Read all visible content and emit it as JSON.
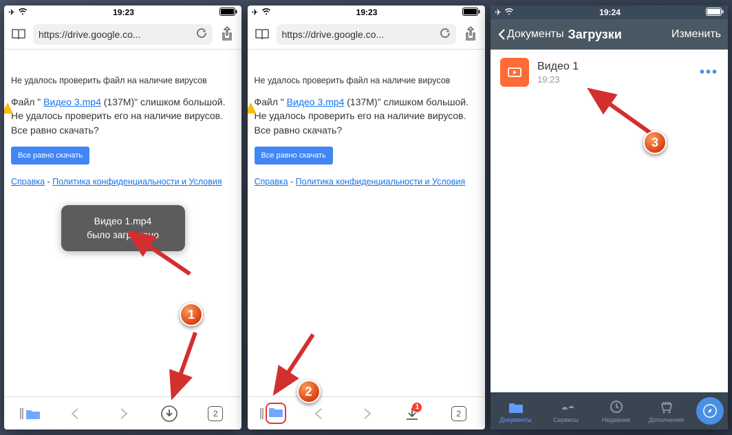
{
  "status": {
    "time1": "19:23",
    "time2": "19:23",
    "time3": "19:24"
  },
  "browser": {
    "url": "https://drive.google.co..."
  },
  "page": {
    "virus_title": "Не удалось проверить файл на наличие вирусов",
    "body_pre": "Файл \" ",
    "file_link": "Видео 3.mp4",
    "body_post": " (137M)\" слишком большой. Не удалось проверить его на наличие вирусов. Все равно скачать?",
    "download_btn": "Все равно скачать",
    "help": "Справка",
    "privacy": "Политика конфиденциальности и Условия "
  },
  "toast": {
    "line1": "Видео 1.mp4",
    "line2": "было загружено"
  },
  "bottom": {
    "tabs_count": "2",
    "badge": "1"
  },
  "phone3": {
    "back": "Документы",
    "title": "Загрузки",
    "edit": "Изменить",
    "file_name": "Видео 1",
    "file_time": "19:23",
    "tab_docs": "Документы",
    "tab_services": "Сервисы",
    "tab_recent": "Недавние",
    "tab_addons": "Дополнения"
  },
  "callouts": {
    "c1": "1",
    "c2": "2",
    "c3": "3"
  }
}
